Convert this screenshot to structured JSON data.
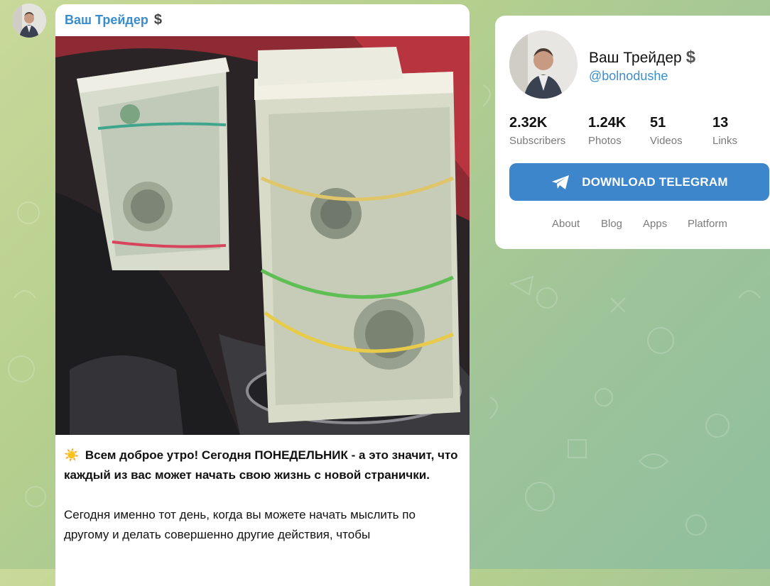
{
  "post": {
    "author": "Ваш Трейдер",
    "author_badge_icon": "dollar-icon",
    "text_emoji": "☀️",
    "paragraph1": "Всем доброе утро! Сегодня ПОНЕДЕЛЬНИК - а это значит, что каждый из вас может начать свою жизнь с новой странички.",
    "paragraph2": "Сегодня именно тот день, когда вы можете начать мыслить по другому и делать совершенно другие действия, чтобы"
  },
  "profile": {
    "name": "Ваш Трейдер",
    "badge_icon": "dollar-icon",
    "handle": "@bolnodushe",
    "stats": [
      {
        "value": "2.32K",
        "label": "Subscribers"
      },
      {
        "value": "1.24K",
        "label": "Photos"
      },
      {
        "value": "51",
        "label": "Videos"
      },
      {
        "value": "13",
        "label": "Links"
      }
    ],
    "download_label": "DOWNLOAD TELEGRAM",
    "links": [
      "About",
      "Blog",
      "Apps",
      "Platform"
    ]
  },
  "colors": {
    "accent": "#3d86cb",
    "link": "#3a8dcc"
  }
}
